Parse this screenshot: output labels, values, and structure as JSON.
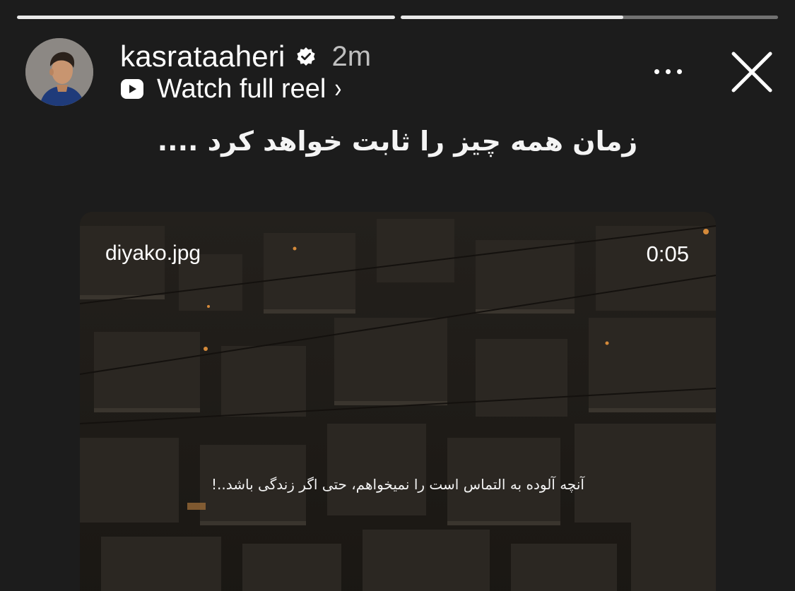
{
  "story": {
    "progress_segments": [
      {
        "fill_fraction": 1.0
      },
      {
        "fill_fraction": 0.59
      }
    ]
  },
  "header": {
    "username": "kasrataaheri",
    "verified_icon": "verified-badge-icon",
    "time_ago": "2m",
    "reel_link_label": "Watch full reel",
    "reel_chevron": "›",
    "more_icon": "more-horizontal-icon",
    "close_icon": "close-icon"
  },
  "caption": "زمان همه چیز را ثابت خواهد کرد ....",
  "media": {
    "source_label": "diyako.jpg",
    "duration": "0:05",
    "subtitle": "آنچه آلوده به التماس است را نمیخواهم، حتی اگر زندگی باشد..!"
  },
  "colors": {
    "background": "#1c1c1c",
    "progress_track": "rgba(255,255,255,0.38)",
    "progress_fill": "#e9e9e9",
    "text_primary": "#ffffff",
    "text_secondary": "rgba(255,255,255,0.72)"
  }
}
